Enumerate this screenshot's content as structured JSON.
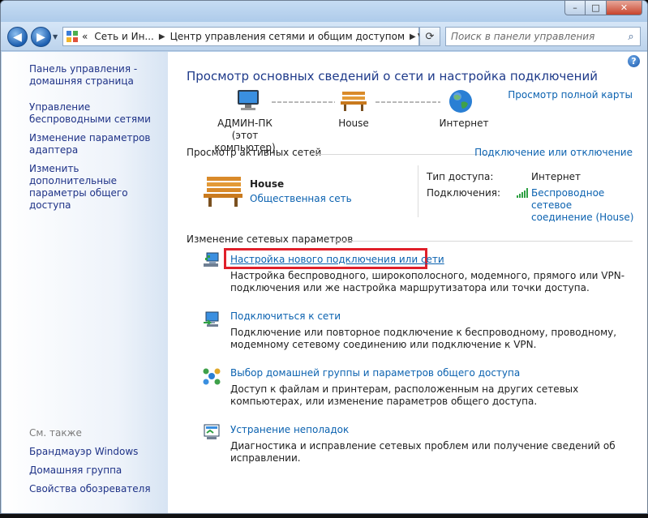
{
  "window": {
    "caption_buttons": {
      "minimize": "–",
      "maximize": "□",
      "close": "✕"
    }
  },
  "navbar": {
    "back_glyph": "◀",
    "forward_glyph": "▶",
    "address_chevrons": "«",
    "breadcrumb": [
      "Сеть и Ин...",
      "Центр управления сетями и общим доступом"
    ],
    "refresh_glyph": "⟳",
    "search_placeholder": "Поиск в панели управления"
  },
  "sidebar": {
    "links": [
      "Панель управления - домашняя страница",
      "Управление беспроводными сетями",
      "Изменение параметров адаптера",
      "Изменить дополнительные параметры общего доступа"
    ],
    "see_also_label": "См. также",
    "see_also": [
      "Брандмауэр Windows",
      "Домашняя группа",
      "Свойства обозревателя"
    ]
  },
  "main": {
    "help_glyph": "?",
    "title": "Просмотр основных сведений о сети и настройка подключений",
    "full_map_link": "Просмотр полной карты",
    "map": {
      "computer_name": "АДМИН-ПК",
      "computer_sub": "(этот компьютер)",
      "network_name": "House",
      "internet_label": "Интернет"
    },
    "active_networks_title": "Просмотр активных сетей",
    "connect_disconnect_link": "Подключение или отключение",
    "active_network": {
      "name": "House",
      "type": "Общественная сеть",
      "access_type_label": "Тип доступа:",
      "access_type_value": "Интернет",
      "connections_label": "Подключения:",
      "connection_line1": "Беспроводное сетевое",
      "connection_line2": "соединение (House)"
    },
    "change_settings_title": "Изменение сетевых параметров",
    "tasks": [
      {
        "title": "Настройка нового подключения или сети",
        "desc": "Настройка беспроводного, широкополосного, модемного, прямого или VPN-подключения или же настройка маршрутизатора или точки доступа."
      },
      {
        "title": "Подключиться к сети",
        "desc": "Подключение или повторное подключение к беспроводному, проводному, модемному сетевому соединению или подключение к VPN."
      },
      {
        "title": "Выбор домашней группы и параметров общего доступа",
        "desc": "Доступ к файлам и принтерам, расположенным на других сетевых компьютерах, или изменение параметров общего доступа."
      },
      {
        "title": "Устранение неполадок",
        "desc": "Диагностика и исправление сетевых проблем или получение сведений об исправлении."
      }
    ]
  },
  "colors": {
    "link": "#0b62b0",
    "title": "#1e3a8a",
    "highlight_border": "#e0202a",
    "sidebar_link": "#1e3287"
  }
}
